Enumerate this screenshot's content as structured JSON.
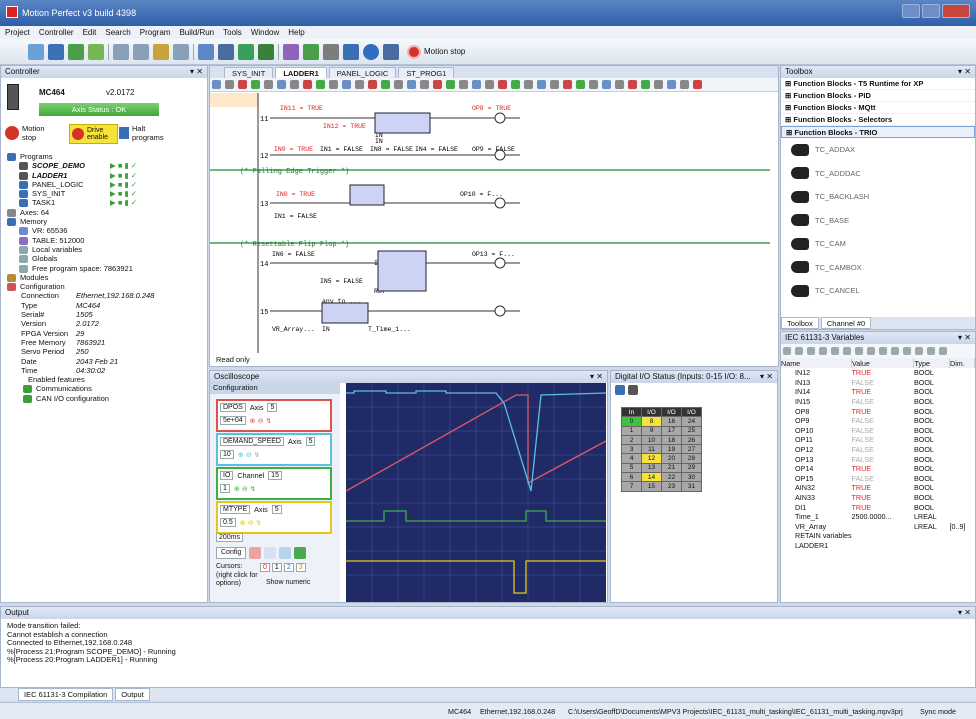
{
  "window": {
    "title": "Motion Perfect v3 build 4398"
  },
  "menu": [
    "Project",
    "Controller",
    "Edit",
    "Search",
    "Program",
    "Build/Run",
    "Tools",
    "Window",
    "Help"
  ],
  "toolbar": {
    "motion_stop": "Motion stop"
  },
  "controller": {
    "title": "Controller",
    "model": "MC464",
    "version": "v2.0172",
    "axis_status": "Axis Status : OK",
    "motion_stop": "Motion stop",
    "drive_enable": "Drive enable",
    "halt_programs": "Halt programs",
    "tree": [
      {
        "label": "Programs",
        "indent": 0
      },
      {
        "label": "SCOPE_DEMO",
        "indent": 1,
        "italic": true
      },
      {
        "label": "LADDER1",
        "indent": 1,
        "italic": true
      },
      {
        "label": "PANEL_LOGIC",
        "indent": 1
      },
      {
        "label": "SYS_INIT",
        "indent": 1
      },
      {
        "label": "TASK1",
        "indent": 1
      },
      {
        "label": "Axes: 64",
        "indent": 0
      },
      {
        "label": "Memory",
        "indent": 0
      },
      {
        "label": "VR: 65536",
        "indent": 1
      },
      {
        "label": "TABLE: 512000",
        "indent": 1
      },
      {
        "label": "Local variables",
        "indent": 1
      },
      {
        "label": "Globals",
        "indent": 1
      },
      {
        "label": "Free program space: 7863921",
        "indent": 1
      },
      {
        "label": "Modules",
        "indent": 0
      },
      {
        "label": "Configuration",
        "indent": 0
      }
    ],
    "config": [
      {
        "k": "Connection",
        "v": "Ethernet,192.168.0.248"
      },
      {
        "k": "Type",
        "v": "MC464"
      },
      {
        "k": "Serial#",
        "v": "1505"
      },
      {
        "k": "Version",
        "v": "2.0172"
      },
      {
        "k": "FPGA Version",
        "v": "29"
      },
      {
        "k": "Free Memory",
        "v": "7863921"
      },
      {
        "k": "Servo Period",
        "v": "250"
      },
      {
        "k": "Date",
        "v": "2043 Feb 21"
      },
      {
        "k": "Time",
        "v": "04:30:02"
      }
    ],
    "tree2": [
      "Enabled features",
      "Communications",
      "CAN I/O configuration"
    ]
  },
  "editor": {
    "tabs": [
      "SYS_INIT",
      "LADDER1",
      "PANEL_LOGIC",
      "ST_PROG1"
    ],
    "active_tab": "LADDER1",
    "comments": [
      "(* Falling Edge Trigger *)",
      "(* Resettable Flip Flop *)"
    ],
    "rungs": [
      "11",
      "12",
      "13",
      "14",
      "15"
    ],
    "labels": [
      "IN11 = TRUE",
      "OP8 = TRUE",
      "IN12 = TRUE",
      "IN",
      "&",
      "Q",
      "IN",
      "IN0 = TRUE",
      "IN1 = FALSE",
      "IN8 = FALSE",
      "IN4 = FALSE",
      "OP9 = FALSE",
      "IN0 = TRUE",
      "Latch1",
      "IN1 = FALSE",
      "OP10 = F...",
      "flip_flop1",
      "IN6 = FALSE",
      "IFlipflop..",
      "IN5 = FALSE",
      "RST",
      "OP13 = F...",
      "any_to_...",
      "VR_Array...",
      "IN",
      "T_Time_1..."
    ],
    "read_only": "Read only"
  },
  "toolbox": {
    "title": "Toolbox",
    "groups": [
      "Function Blocks - T5 Runtime for XP",
      "Function Blocks - PID",
      "Function Blocks - MQtt",
      "Function Blocks - Selectors",
      "Function Blocks - TRIO"
    ],
    "items": [
      "TC_ADDAX",
      "TC_ADDDAC",
      "TC_BACKLASH",
      "TC_BASE",
      "TC_CAM",
      "TC_CAMBOX",
      "TC_CANCEL"
    ],
    "tabs": [
      "Toolbox",
      "Channel #0"
    ]
  },
  "variables": {
    "title": "IEC 61131-3 Variables",
    "headers": [
      "Name",
      "Value",
      "Type",
      "Dim."
    ],
    "rows": [
      [
        "IN12",
        "TRUE",
        "BOOL",
        ""
      ],
      [
        "IN13",
        "FALSE",
        "BOOL",
        ""
      ],
      [
        "IN14",
        "TRUE",
        "BOOL",
        ""
      ],
      [
        "IN15",
        "FALSE",
        "BOOL",
        ""
      ],
      [
        "OP8",
        "TRUE",
        "BOOL",
        ""
      ],
      [
        "OP9",
        "FALSE",
        "BOOL",
        ""
      ],
      [
        "OP10",
        "FALSE",
        "BOOL",
        ""
      ],
      [
        "OP11",
        "FALSE",
        "BOOL",
        ""
      ],
      [
        "OP12",
        "FALSE",
        "BOOL",
        ""
      ],
      [
        "OP13",
        "FALSE",
        "BOOL",
        ""
      ],
      [
        "OP14",
        "TRUE",
        "BOOL",
        ""
      ],
      [
        "OP15",
        "FALSE",
        "BOOL",
        ""
      ],
      [
        "AIN32",
        "TRUE",
        "BOOL",
        ""
      ],
      [
        "AIN33",
        "TRUE",
        "BOOL",
        ""
      ],
      [
        "DI1",
        "TRUE",
        "BOOL",
        ""
      ],
      [
        "Time_1",
        "2500.0000...",
        "LREAL",
        ""
      ],
      [
        "VR_Array",
        "",
        "LREAL",
        "[0..9]"
      ]
    ],
    "footer": [
      "RETAIN variables",
      "LADDER1"
    ]
  },
  "oscilloscope": {
    "title": "Oscilloscope",
    "config": "Configuration",
    "channels": [
      {
        "name": "DPOS",
        "axis_label": "Axis",
        "axis": "5",
        "scale": "5e+04",
        "color": "#d9534f"
      },
      {
        "name": "DEMAND_SPEED",
        "axis_label": "Axis",
        "axis": "5",
        "scale": "10",
        "color": "#5bc0de"
      },
      {
        "name": "IO",
        "axis_label": "Channel",
        "axis": "15",
        "scale": "1",
        "color": "#3cb043"
      },
      {
        "name": "MTYPE",
        "axis_label": "Axis",
        "axis": "5",
        "scale": "0.5",
        "color": "#e6c619"
      }
    ],
    "timebase": "200ms",
    "config_btn": "Config",
    "cursors": "Cursors:",
    "cursor_nums": [
      "0",
      "1",
      "2",
      "3"
    ],
    "right_click": "(right click for options)",
    "show_numeric": "Show numeric"
  },
  "digital_io": {
    "title": "Digital I/O Status (Inputs: 0-15  I/O: 8...",
    "headers": [
      "In",
      "I/O",
      "I/O",
      "I/O"
    ],
    "rows": [
      [
        "0",
        "8",
        "16",
        "24"
      ],
      [
        "1",
        "9",
        "17",
        "25"
      ],
      [
        "2",
        "10",
        "18",
        "26"
      ],
      [
        "3",
        "11",
        "19",
        "27"
      ],
      [
        "4",
        "12",
        "20",
        "28"
      ],
      [
        "5",
        "13",
        "21",
        "29"
      ],
      [
        "6",
        "14",
        "22",
        "30"
      ],
      [
        "7",
        "15",
        "23",
        "31"
      ]
    ]
  },
  "output": {
    "title": "Output",
    "lines": [
      "Mode transition failed:",
      "Cannot establish a connection",
      "Connected to Ethernet,192.168.0.248",
      "%[Process 21:Program SCOPE_DEMO] - Running",
      "%[Process 20:Program LADDER1] - Running"
    ],
    "tabs": [
      "IEC 61131-3 Compilation",
      "Output"
    ]
  },
  "status": {
    "model": "MC464",
    "connection": "Ethernet,192.168.0.248",
    "path": "C:\\Users\\GeoffD\\Documents\\MPV3 Projects\\IEC_61131_multi_tasking\\IEC_61131_multi_tasking.mpv3prj",
    "sync": "Sync mode"
  }
}
